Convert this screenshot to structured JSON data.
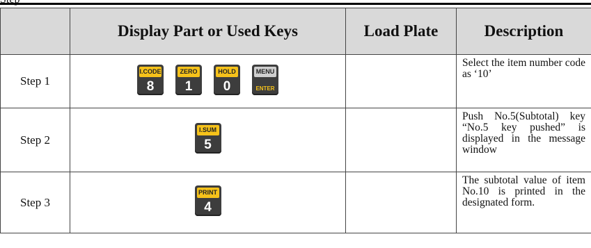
{
  "cut_text": "Step",
  "table": {
    "headers": [
      "",
      "Display Part or Used Keys",
      "Load Plate",
      "Description"
    ],
    "rows": [
      {
        "step": "Step 1",
        "keys": [
          {
            "tag": "I.CODE",
            "num": "8"
          },
          {
            "tag": "ZERO",
            "num": "1"
          },
          {
            "tag": "HOLD",
            "num": "0"
          },
          {
            "tag": "MENU",
            "sub": "ENTER"
          }
        ],
        "load_plate": "",
        "description": "Select the item number code as ‘10’"
      },
      {
        "step": "Step 2",
        "keys": [
          {
            "tag": "I.SUM",
            "num": "5"
          }
        ],
        "load_plate": "",
        "description": "Push No.5(Subtotal) key “No.5 key pushed” is displayed in the message window"
      },
      {
        "step": "Step 3",
        "keys": [
          {
            "tag": "PRINT",
            "num": "4"
          }
        ],
        "load_plate": "",
        "description": "The subtotal value of item No.10 is printed in the designated form."
      }
    ]
  },
  "colors": {
    "key_body": "#3d3d3d",
    "key_tag_yellow": "#f6c21a",
    "key_tag_grey": "#cfcfcf",
    "header_bg": "#d9d9d9"
  }
}
